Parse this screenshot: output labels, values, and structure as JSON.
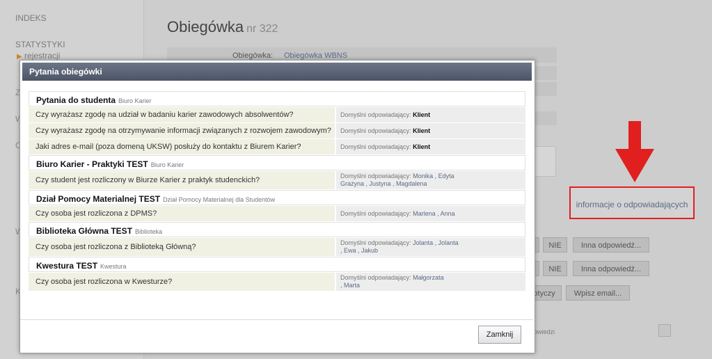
{
  "sidebar": {
    "items": [
      "INDEKS",
      "STATYSTYKI",
      "rejestracji"
    ],
    "partial_letters": [
      "Z",
      "W",
      "C",
      "W",
      "K"
    ]
  },
  "page": {
    "title": "Obiegówka",
    "nr": "nr 322",
    "label_obiegowka": "Obiegówka:",
    "value_obiegowka": "Obiegówka WBNS",
    "info_link": "informacje o odpowiadających"
  },
  "bg_buttons": {
    "nie": "NIE",
    "inna": "Inna odpowiedź...",
    "tyczy": "otyczy",
    "wpisz": "Wpisz email...",
    "odpowiedzi": "owiedzi"
  },
  "modal": {
    "title": "Pytania obiegówki",
    "close_label": "Zamknij",
    "default_label": "Domyślni odpowiadający:",
    "sections": [
      {
        "title": "Pytania do studenta",
        "sub": "Biuro Karier",
        "questions": [
          {
            "q": "Czy wyrażasz zgodę na udział w badaniu karier zawodowych absolwentów?",
            "l1": "Klient",
            "l2": ""
          },
          {
            "q": "Czy wyrażasz zgodę na otrzymywanie informacji związanych z rozwojem zawodowym?",
            "l1": "Klient",
            "l2": ""
          },
          {
            "q": "Jaki adres e-mail (poza domeną UKSW) posłuży do kontaktu z Biurem Karier?",
            "l1": "Klient",
            "l2": ""
          }
        ]
      },
      {
        "title": "Biuro Karier - Praktyki TEST",
        "sub": "Biuro Karier",
        "questions": [
          {
            "q": "Czy student jest rozliczony w Biurze Karier z praktyk studenckich?",
            "l1": "Monika    ,    Edyta",
            "l2": "Grażyna    , Justyna    , Magdalena"
          }
        ]
      },
      {
        "title": "Dział Pomocy Materialnej TEST",
        "sub": "Dział Pomocy Materialnej dla Studentów",
        "questions": [
          {
            "q": "Czy osoba jest rozliczona z DPMS?",
            "l1": "Marlena    , Anna",
            "l2": ""
          }
        ]
      },
      {
        "title": "Biblioteka Główna TEST",
        "sub": "Biblioteka",
        "questions": [
          {
            "q": "Czy osoba jest rozliczona z Biblioteką Główną?",
            "l1": "Jolanta    , Jolanta",
            "l2": ", Ewa    , Jakub"
          }
        ]
      },
      {
        "title": "Kwestura TEST",
        "sub": "Kwestura",
        "questions": [
          {
            "q": "Czy osoba jest rozliczona w Kwesturze?",
            "l1": "Małgorzata",
            "l2": ", Marta"
          }
        ]
      }
    ]
  },
  "colors": {
    "header": "#5a6275",
    "question_bg": "#f0f1e3",
    "link": "#5a6b86",
    "highlight": "#e11f1f"
  }
}
